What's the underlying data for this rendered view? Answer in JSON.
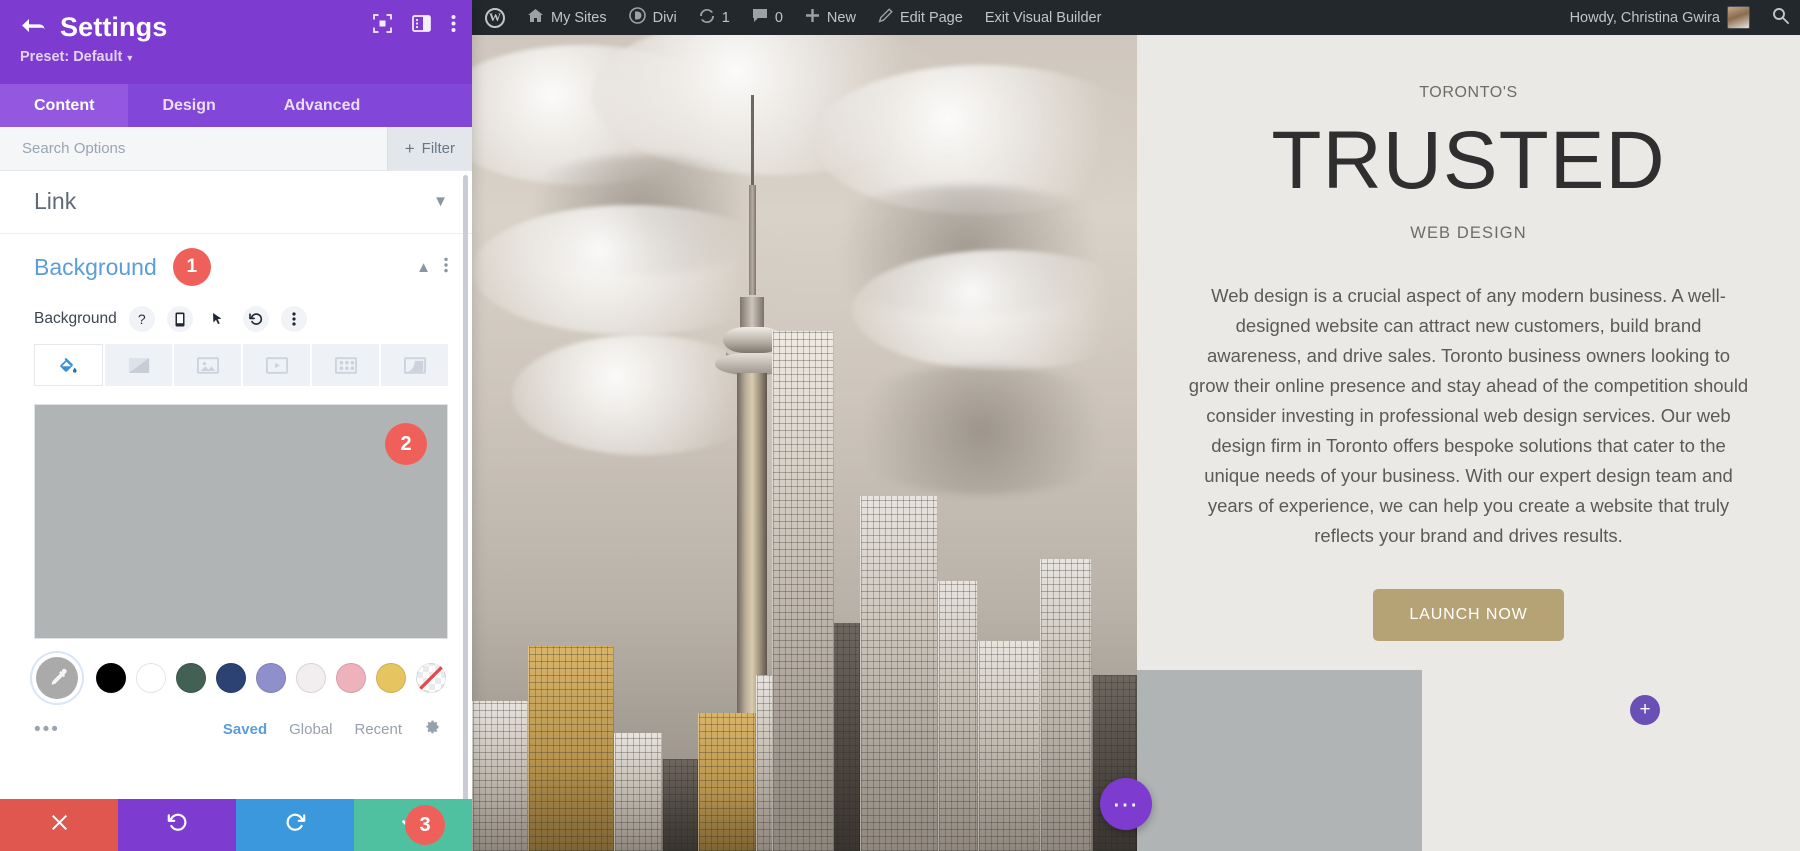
{
  "settings_panel": {
    "title": "Settings",
    "back_icon": "back-arrow-icon",
    "preset_label": "Preset: Default",
    "header_icons": [
      {
        "name": "focus-frame-icon"
      },
      {
        "name": "layout-panel-icon"
      },
      {
        "name": "vertical-dots-icon"
      }
    ],
    "tabs": [
      {
        "label": "Content",
        "active": true
      },
      {
        "label": "Design",
        "active": false
      },
      {
        "label": "Advanced",
        "active": false
      }
    ],
    "search": {
      "placeholder": "Search Options",
      "value": ""
    },
    "filter_button": {
      "label": "Filter",
      "icon": "plus-icon"
    },
    "sections": [
      {
        "title": "Link",
        "state": "collapsed"
      },
      {
        "title": "Background",
        "state": "expanded",
        "badge": "1"
      }
    ],
    "background_field": {
      "label": "Background",
      "control_icons": [
        {
          "name": "help-question-icon",
          "glyph": "?"
        },
        {
          "name": "responsive-phone-icon",
          "glyph": "phone"
        },
        {
          "name": "hover-cursor-icon",
          "glyph": "cursor"
        },
        {
          "name": "reset-undo-icon",
          "glyph": "undo"
        },
        {
          "name": "vertical-dots-icon",
          "glyph": "dots"
        }
      ],
      "type_tabs": [
        {
          "name": "background-color-tab",
          "icon": "paint-bucket-icon",
          "active": true
        },
        {
          "name": "background-gradient-tab",
          "icon": "gradient-icon",
          "active": false
        },
        {
          "name": "background-image-tab",
          "icon": "image-icon",
          "active": false
        },
        {
          "name": "background-video-tab",
          "icon": "video-icon",
          "active": false
        },
        {
          "name": "background-pattern-tab",
          "icon": "pattern-icon",
          "active": false
        },
        {
          "name": "background-mask-tab",
          "icon": "mask-icon",
          "active": false
        }
      ],
      "preview_color": "#b0b4b4",
      "preview_badge": "2",
      "eyedropper_icon": "eyedropper-icon",
      "swatches": [
        {
          "name": "swatch-black",
          "color": "#000000"
        },
        {
          "name": "swatch-white",
          "color": "#ffffff"
        },
        {
          "name": "swatch-green",
          "color": "#436055"
        },
        {
          "name": "swatch-navy",
          "color": "#2b4272"
        },
        {
          "name": "swatch-periwinkle",
          "color": "#8f8fcb"
        },
        {
          "name": "swatch-offwhite",
          "color": "#f2eef0"
        },
        {
          "name": "swatch-pink",
          "color": "#eeb2bd"
        },
        {
          "name": "swatch-gold",
          "color": "#e6c45f"
        },
        {
          "name": "swatch-none",
          "color": "transparent"
        }
      ],
      "palette_tabs": [
        {
          "label": "Saved",
          "active": true
        },
        {
          "label": "Global",
          "active": false
        },
        {
          "label": "Recent",
          "active": false
        }
      ],
      "more_dots": "•••",
      "gear_icon": "gear-icon"
    },
    "action_bar": [
      {
        "name": "cancel-button",
        "icon": "close-x-icon",
        "color": "#e0574f"
      },
      {
        "name": "undo-button",
        "icon": "undo-icon",
        "color": "#7e3bd0"
      },
      {
        "name": "redo-button",
        "icon": "redo-icon",
        "color": "#3b98dd"
      },
      {
        "name": "save-button",
        "icon": "check-icon",
        "color": "#4fc1a0"
      }
    ],
    "action_badge": "3"
  },
  "admin_bar": {
    "items": [
      {
        "name": "wp-logo",
        "label": "",
        "icon": "wordpress-logo-icon"
      },
      {
        "name": "my-sites",
        "label": "My Sites",
        "icon": "sites-house-icon"
      },
      {
        "name": "divi",
        "label": "Divi",
        "icon": "divi-icon"
      },
      {
        "name": "updates",
        "label": "1",
        "icon": "update-arrows-icon"
      },
      {
        "name": "comments",
        "label": "0",
        "icon": "comment-bubble-icon"
      },
      {
        "name": "new",
        "label": "New",
        "icon": "plus-icon"
      },
      {
        "name": "edit-page",
        "label": "Edit Page",
        "icon": "pencil-icon"
      },
      {
        "name": "exit-visual-builder",
        "label": "Exit Visual Builder",
        "icon": ""
      }
    ],
    "account": {
      "greeting": "Howdy, Christina Gwira",
      "avatar": "user-avatar"
    },
    "search_icon": "search-icon"
  },
  "page_content": {
    "eyebrow": "TORONTO'S",
    "headline": "TRUSTED",
    "subhead": "WEB DESIGN",
    "body": "Web design is a crucial aspect of any modern business. A well-designed website can attract new customers, build brand awareness, and drive sales. Toronto business owners looking to grow their online presence and stay ahead of the competition should consider investing in professional web design services. Our web design firm in Toronto offers bespoke solutions that cater to the unique needs of your business. With our expert design team and years of experience, we can help you create a website that truly reflects your brand and drives results.",
    "cta_label": "LAUNCH NOW",
    "add_module_icon": "plus-icon",
    "floating_menu_icon": "three-dots-icon",
    "accent_color": "#b6a375",
    "grey_block_color": "#b0b4b4"
  }
}
